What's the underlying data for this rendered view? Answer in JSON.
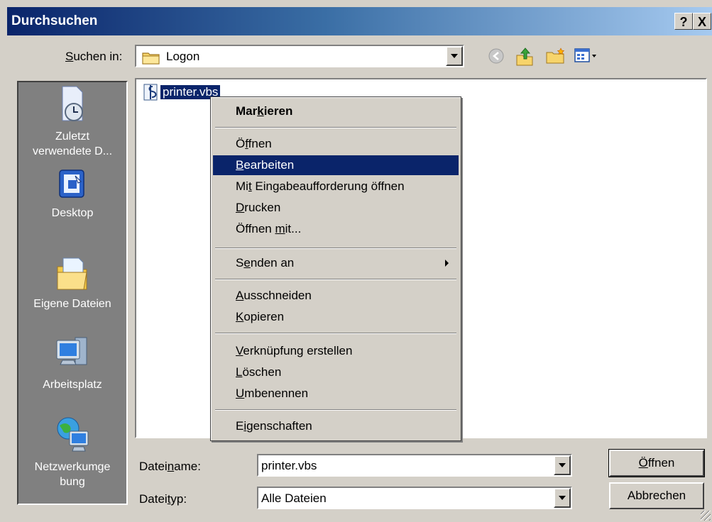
{
  "window": {
    "title": "Durchsuchen",
    "help_glyph": "?",
    "close_glyph": "X"
  },
  "lookin": {
    "label_pre": "",
    "label_accel": "S",
    "label_post": "uchen in:",
    "value": "Logon"
  },
  "toolbar": {
    "icons": [
      "back-icon",
      "up-folder-icon",
      "new-folder-icon",
      "view-menu-icon"
    ]
  },
  "places": [
    {
      "label1": "Zuletzt",
      "label2": "verwendete D...",
      "icon": "recent-documents-icon"
    },
    {
      "label1": "Desktop",
      "label2": "",
      "icon": "desktop-icon"
    },
    {
      "label1": "Eigene Dateien",
      "label2": "",
      "icon": "my-documents-icon"
    },
    {
      "label1": "Arbeitsplatz",
      "label2": "",
      "icon": "my-computer-icon"
    },
    {
      "label1": "Netzwerkumge",
      "label2": "bung",
      "icon": "network-places-icon"
    }
  ],
  "file": {
    "name": "printer.vbs",
    "icon": "vbscript-file-icon"
  },
  "context_menu": {
    "items": [
      {
        "pre": "Mar",
        "accel": "k",
        "post": "ieren"
      },
      {
        "pre": "Ö",
        "accel": "f",
        "post": "fnen"
      },
      {
        "pre": "",
        "accel": "B",
        "post": "earbeiten"
      },
      {
        "pre": "Mi",
        "accel": "t",
        "post": " Eingabeaufforderung öffnen"
      },
      {
        "pre": "",
        "accel": "D",
        "post": "rucken"
      },
      {
        "pre": "Öffnen ",
        "accel": "m",
        "post": "it..."
      },
      {
        "pre": "S",
        "accel": "e",
        "post": "nden an"
      },
      {
        "pre": "",
        "accel": "A",
        "post": "usschneiden"
      },
      {
        "pre": "",
        "accel": "K",
        "post": "opieren"
      },
      {
        "pre": "",
        "accel": "V",
        "post": "erknüpfung erstellen"
      },
      {
        "pre": "",
        "accel": "L",
        "post": "öschen"
      },
      {
        "pre": "",
        "accel": "U",
        "post": "mbenennen"
      },
      {
        "pre": "E",
        "accel": "i",
        "post": "genschaften"
      }
    ],
    "highlighted": "Bearbeiten"
  },
  "filename": {
    "label_pre": "Datei",
    "label_accel": "n",
    "label_post": "ame:",
    "value": "printer.vbs"
  },
  "filetype": {
    "label_pre": "Datei",
    "label_accel": "t",
    "label_post": "yp:",
    "value": "Alle Dateien"
  },
  "buttons": {
    "open": {
      "pre": "",
      "accel": "Ö",
      "post": "ffnen"
    },
    "cancel": "Abbrechen"
  },
  "colors": {
    "highlight": "#0a246a",
    "face": "#d4d0c8",
    "places_bg": "#808080"
  }
}
